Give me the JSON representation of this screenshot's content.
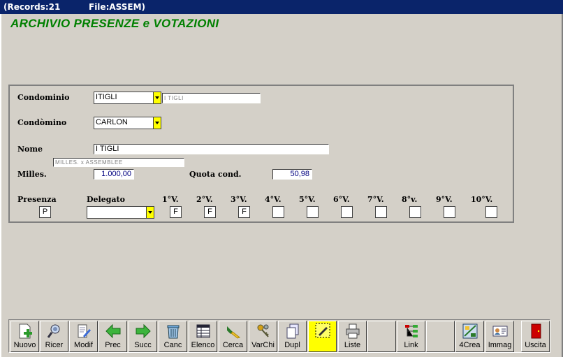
{
  "titlebar": {
    "records": "(Records:21",
    "file": "File:ASSEM)"
  },
  "app_title": "ARCHIVIO PRESENZE e VOTAZIONI",
  "form": {
    "condominio_label": "Condominio",
    "condominio_value": "ITIGLI",
    "condominio_desc": "I TIGLI",
    "condomino_label": "Condòmino",
    "condomino_value": "CARLON",
    "nome_label": "Nome",
    "nome_value": "I TIGLI",
    "milles_assemblee": "MILLES. x ASSEMBLEE",
    "milles_label": "Milles.",
    "milles_value": "1.000,00",
    "quota_label": "Quota cond.",
    "quota_value": "50,98",
    "presenza_label": "Presenza",
    "presenza_value": "P",
    "delegato_label": "Delegato",
    "delegato_value": "",
    "votes": [
      {
        "label": "1°V.",
        "value": "F"
      },
      {
        "label": "2°V.",
        "value": "F"
      },
      {
        "label": "3°V.",
        "value": "F"
      },
      {
        "label": "4°V.",
        "value": ""
      },
      {
        "label": "5°V.",
        "value": ""
      },
      {
        "label": "6°V.",
        "value": ""
      },
      {
        "label": "7°V.",
        "value": ""
      },
      {
        "label": "8°v.",
        "value": ""
      },
      {
        "label": "9°V.",
        "value": ""
      },
      {
        "label": "10°V.",
        "value": ""
      }
    ]
  },
  "toolbar": [
    {
      "label": "Nuovo",
      "icon": "new-doc-icon"
    },
    {
      "label": "Ricer",
      "icon": "magnifier-icon"
    },
    {
      "label": "Modif",
      "icon": "edit-doc-icon"
    },
    {
      "label": "Prec",
      "icon": "arrow-left-icon"
    },
    {
      "label": "Succ",
      "icon": "arrow-right-icon"
    },
    {
      "label": "Canc",
      "icon": "trash-icon"
    },
    {
      "label": "Elenco",
      "icon": "list-table-icon"
    },
    {
      "label": "Cerca",
      "icon": "flashlight-icon"
    },
    {
      "label": "VarChi",
      "icon": "keys-icon"
    },
    {
      "label": "Dupl",
      "icon": "duplicate-icon"
    },
    {
      "label": "",
      "icon": "pencil-grid-icon"
    },
    {
      "label": "Liste",
      "icon": "printer-icon"
    },
    {
      "label": "",
      "icon": ""
    },
    {
      "label": "Link",
      "icon": "tree-link-icon"
    },
    {
      "label": "",
      "icon": ""
    },
    {
      "label": "4Crea",
      "icon": "crea-icon"
    },
    {
      "label": "Immag",
      "icon": "id-card-icon"
    },
    {
      "label": "Uscita",
      "icon": "exit-door-icon"
    }
  ],
  "colors": {
    "title_green": "#008000",
    "titlebar_blue": "#0a246a",
    "combo_yellow": "#ffff00",
    "face": "#d4d0c8"
  }
}
